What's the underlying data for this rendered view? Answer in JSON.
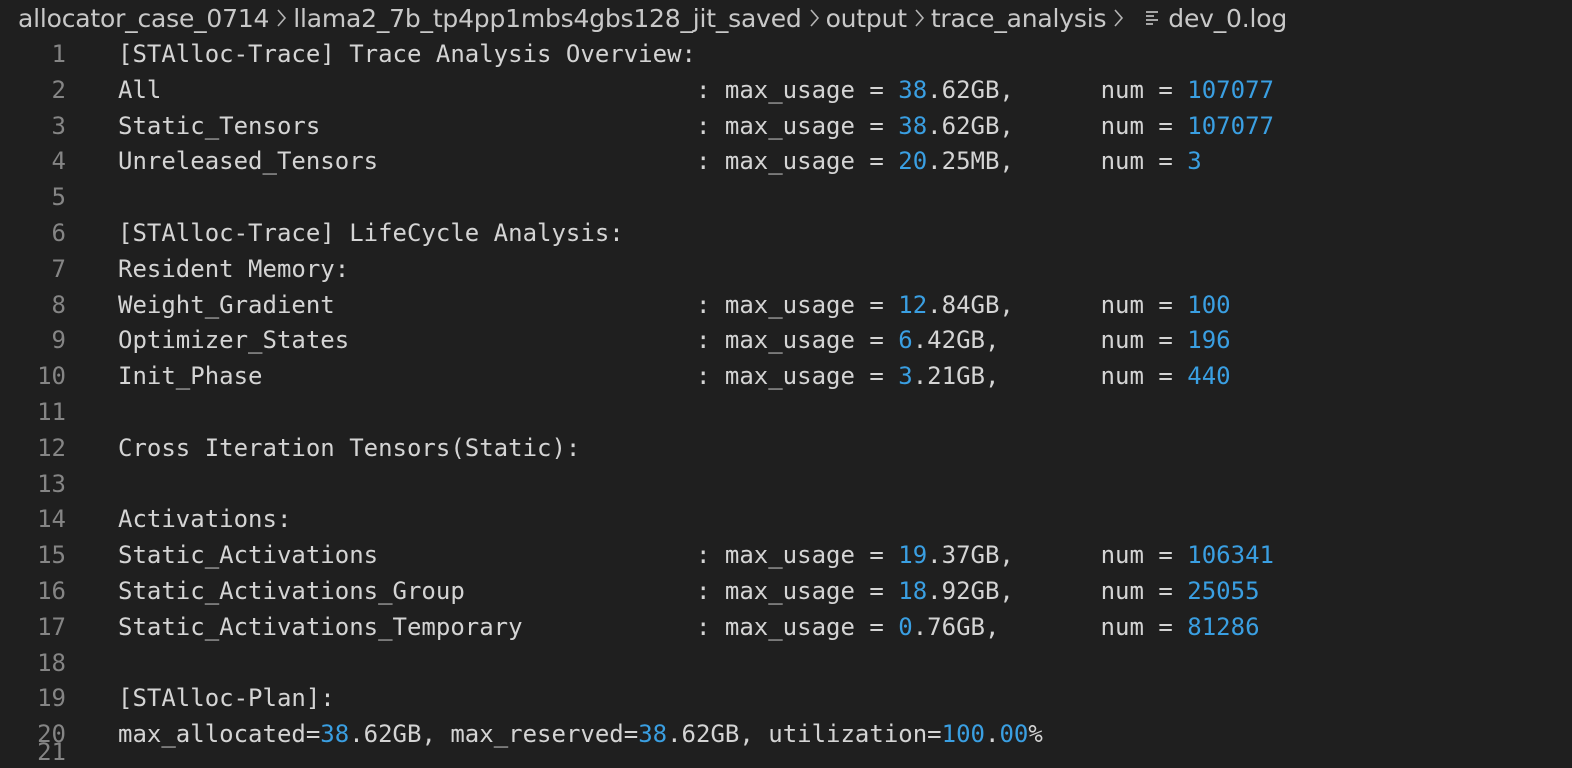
{
  "breadcrumb": {
    "items": [
      "allocator_case_0714",
      "llama2_7b_tp4pp1mbs4gbs128_jit_saved",
      "output",
      "trace_analysis"
    ],
    "file": "dev_0.log",
    "file_icon": "list-file-icon"
  },
  "colors": {
    "background": "#1f1f1f",
    "text": "#d4d4d4",
    "number": "#3a9fe2",
    "line_number": "#858585"
  },
  "lines": [
    {
      "n": "1",
      "segments": [
        {
          "t": "[STAlloc-Trace] Trace Analysis Overview:"
        }
      ]
    },
    {
      "n": "2",
      "segments": [
        {
          "t": "All                                     : max_usage = "
        },
        {
          "t": "38",
          "c": "num"
        },
        {
          "t": ".62GB,      num = "
        },
        {
          "t": "107077",
          "c": "num"
        }
      ]
    },
    {
      "n": "3",
      "segments": [
        {
          "t": "Static_Tensors                          : max_usage = "
        },
        {
          "t": "38",
          "c": "num"
        },
        {
          "t": ".62GB,      num = "
        },
        {
          "t": "107077",
          "c": "num"
        }
      ]
    },
    {
      "n": "4",
      "segments": [
        {
          "t": "Unreleased_Tensors                      : max_usage = "
        },
        {
          "t": "20",
          "c": "num"
        },
        {
          "t": ".25MB,      num = "
        },
        {
          "t": "3",
          "c": "num"
        }
      ]
    },
    {
      "n": "5",
      "segments": []
    },
    {
      "n": "6",
      "segments": [
        {
          "t": "[STAlloc-Trace] LifeCycle Analysis:"
        }
      ]
    },
    {
      "n": "7",
      "segments": [
        {
          "t": "Resident Memory:"
        }
      ]
    },
    {
      "n": "8",
      "segments": [
        {
          "t": "Weight_Gradient                         : max_usage = "
        },
        {
          "t": "12",
          "c": "num"
        },
        {
          "t": ".84GB,      num = "
        },
        {
          "t": "100",
          "c": "num"
        }
      ]
    },
    {
      "n": "9",
      "segments": [
        {
          "t": "Optimizer_States                        : max_usage = "
        },
        {
          "t": "6",
          "c": "num"
        },
        {
          "t": ".42GB,       num = "
        },
        {
          "t": "196",
          "c": "num"
        }
      ]
    },
    {
      "n": "10",
      "segments": [
        {
          "t": "Init_Phase                              : max_usage = "
        },
        {
          "t": "3",
          "c": "num"
        },
        {
          "t": ".21GB,       num = "
        },
        {
          "t": "440",
          "c": "num"
        }
      ]
    },
    {
      "n": "11",
      "segments": []
    },
    {
      "n": "12",
      "segments": [
        {
          "t": "Cross Iteration Tensors(Static):"
        }
      ]
    },
    {
      "n": "13",
      "segments": []
    },
    {
      "n": "14",
      "segments": [
        {
          "t": "Activations:"
        }
      ]
    },
    {
      "n": "15",
      "segments": [
        {
          "t": "Static_Activations                      : max_usage = "
        },
        {
          "t": "19",
          "c": "num"
        },
        {
          "t": ".37GB,      num = "
        },
        {
          "t": "106341",
          "c": "num"
        }
      ]
    },
    {
      "n": "16",
      "segments": [
        {
          "t": "Static_Activations_Group                : max_usage = "
        },
        {
          "t": "18",
          "c": "num"
        },
        {
          "t": ".92GB,      num = "
        },
        {
          "t": "25055",
          "c": "num"
        }
      ]
    },
    {
      "n": "17",
      "segments": [
        {
          "t": "Static_Activations_Temporary            : max_usage = "
        },
        {
          "t": "0",
          "c": "num"
        },
        {
          "t": ".76GB,       num = "
        },
        {
          "t": "81286",
          "c": "num"
        }
      ]
    },
    {
      "n": "18",
      "segments": []
    },
    {
      "n": "19",
      "segments": [
        {
          "t": "[STAlloc-Plan]:"
        }
      ]
    },
    {
      "n": "20",
      "segments": [
        {
          "t": "max_allocated="
        },
        {
          "t": "38",
          "c": "num"
        },
        {
          "t": ".62GB, max_reserved="
        },
        {
          "t": "38",
          "c": "num"
        },
        {
          "t": ".62GB, utilization="
        },
        {
          "t": "100",
          "c": "num"
        },
        {
          "t": "."
        },
        {
          "t": "00",
          "c": "num"
        },
        {
          "t": "%"
        }
      ]
    },
    {
      "n": "21",
      "segments": []
    }
  ]
}
